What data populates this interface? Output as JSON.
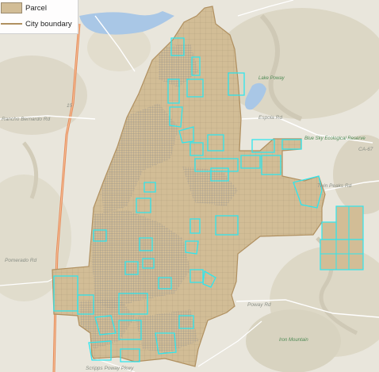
{
  "legend": {
    "items": [
      {
        "label": "Parcel",
        "color": "#d2bd96"
      },
      {
        "label": "City boundary",
        "color": "#b09060"
      }
    ]
  },
  "map": {
    "colors": {
      "background": "#e9e6dc",
      "parcel": "#d2bd96",
      "city_boundary": "#b09060",
      "highlight": "#2ee6ee",
      "water": "#a9c7e6",
      "highway": "#e58a5a"
    },
    "labels": {
      "road_rancho_bernardo": "Rancho Bernardo Rd",
      "road_poway": "Poway Rd",
      "road_espola": "Espola Rd",
      "road_twin_peaks": "Twin Peaks Rd",
      "road_pomerado": "Pomerado Rd",
      "road_scripps_poway": "Scripps Poway Pkwy",
      "road_sr67": "CA-67",
      "road_i15": "15",
      "park_lake_poway": "Lake Poway",
      "park_blue_sky": "Blue Sky Ecological Reserve",
      "park_iron_mountain": "Iron Mountain"
    }
  }
}
